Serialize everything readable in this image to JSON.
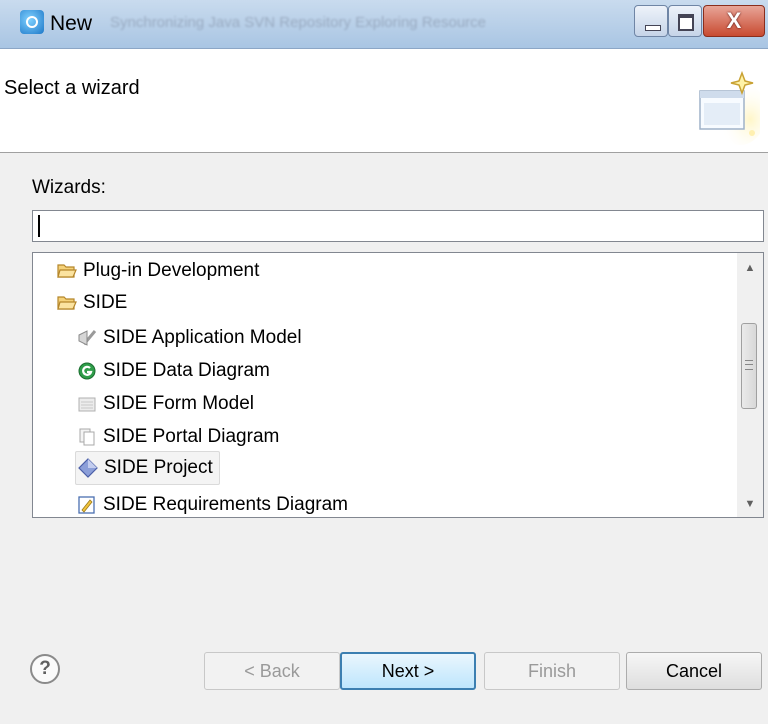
{
  "window": {
    "title": "New",
    "background_tabs": "Synchronizing   Java   SVN Repository Exploring   Resource"
  },
  "header": {
    "heading": "Select a wizard"
  },
  "wizards": {
    "label": "Wizards:",
    "filter_value": "",
    "items": [
      {
        "label": "Plug-in Development",
        "icon": "folder-icon",
        "level": 1
      },
      {
        "label": "SIDE",
        "icon": "folder-open-icon",
        "level": 1
      },
      {
        "label": "SIDE Application Model",
        "icon": "checkmark-shield-icon",
        "level": 2
      },
      {
        "label": "SIDE Data Diagram",
        "icon": "green-circle-icon",
        "level": 2
      },
      {
        "label": "SIDE Form Model",
        "icon": "form-icon",
        "level": 2
      },
      {
        "label": "SIDE Portal Diagram",
        "icon": "pages-icon",
        "level": 2
      },
      {
        "label": "SIDE Project",
        "icon": "diamond-icon",
        "level": 2,
        "selected": true
      },
      {
        "label": "SIDE Requirements Diagram",
        "icon": "requirements-icon",
        "level": 2
      }
    ]
  },
  "buttons": {
    "help": "?",
    "back": "< Back",
    "next": "Next >",
    "finish": "Finish",
    "cancel": "Cancel"
  },
  "colors": {
    "titlebar": "#a9c5e3",
    "close_button": "#c84a30",
    "default_button_border": "#3c7fb1",
    "folder": "#e8b84a"
  }
}
